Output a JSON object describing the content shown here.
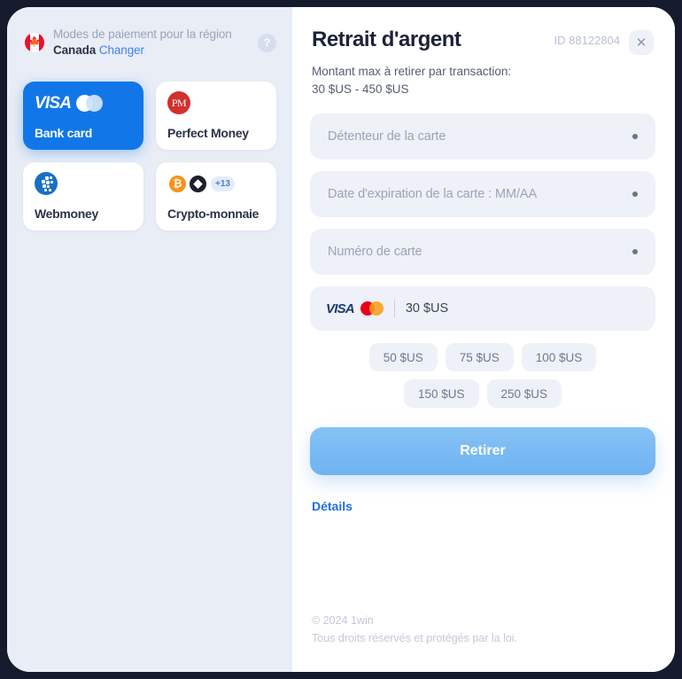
{
  "region": {
    "flag_icon": "canada-flag-icon",
    "line1": "Modes de paiement pour la région",
    "country": "Canada",
    "change_label": "Changer",
    "help_icon": "help-question-icon",
    "help_glyph": "?"
  },
  "methods": [
    {
      "id": "bank-card",
      "label": "Bank card",
      "active": true,
      "logos": "visa-mastercard"
    },
    {
      "id": "perfect-money",
      "label": "Perfect Money",
      "active": false,
      "logos": "perfect-money",
      "mark": "PM"
    },
    {
      "id": "webmoney",
      "label": "Webmoney",
      "active": false,
      "logos": "webmoney"
    },
    {
      "id": "crypto",
      "label": "Crypto-monnaie",
      "active": false,
      "logos": "crypto",
      "btc": "₿",
      "eth": "◆",
      "more": "+13"
    }
  ],
  "panel": {
    "title": "Retrait d'argent",
    "id_label": "ID 88122804",
    "close_icon": "close-icon",
    "close_glyph": "✕",
    "limit_line1": "Montant max à retirer par transaction:",
    "limit_line2": "30 $US - 450 $US"
  },
  "fields": [
    {
      "name": "card-holder",
      "placeholder": "Détenteur de la carte"
    },
    {
      "name": "card-expiry",
      "placeholder": "Date d'expiration de la carte : MM/AA"
    },
    {
      "name": "card-number",
      "placeholder": "Numéro de carte"
    }
  ],
  "amount": {
    "value": "30 $US",
    "visa_label": "VISA"
  },
  "quick_amounts": [
    "50 $US",
    "75 $US",
    "100 $US",
    "150 $US",
    "250 $US"
  ],
  "submit_label": "Retirer",
  "details_label": "Détails",
  "footer": {
    "line1": "© 2024 1win",
    "line2": "Tous droits réservés et protégés par la loi."
  },
  "colors": {
    "accent_blue": "#1177e8",
    "link_blue": "#1e6fe0",
    "button_blue": "#6fb3f2",
    "panel_bg": "#e9edf6",
    "field_bg": "#eef1f8",
    "backdrop": "#151b2c"
  }
}
